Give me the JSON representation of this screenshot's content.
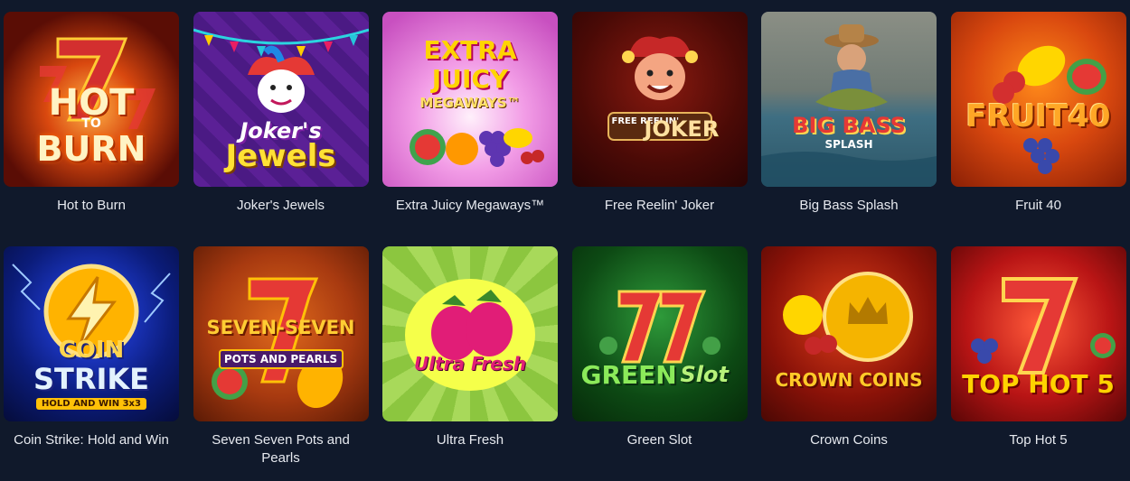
{
  "games": [
    {
      "title": "Hot to Burn",
      "logo": "HOT",
      "logo2": "TO",
      "logo3": "BURN",
      "icon": "flaming-seven-icon",
      "bg": "#5a0d05",
      "accent": "#ff7a1a"
    },
    {
      "title": "Joker's Jewels",
      "logo": "Joker's",
      "logo2": "Jewels",
      "icon": "jester-icon",
      "bg": "#4b1a84",
      "accent": "#ffd23a"
    },
    {
      "title": "Extra Juicy Megaways™",
      "logo": "EXTRA",
      "logo2": "JUICY",
      "logo3": "MEGAWAYS™",
      "icon": "fruit-icon",
      "bg": "#e07bd8",
      "accent": "#ffd400"
    },
    {
      "title": "Free Reelin' Joker",
      "logo": "FREE REELIN'",
      "logo2": "JOKER",
      "icon": "joker-face-icon",
      "bg": "#3a0806",
      "accent": "#e7b45a"
    },
    {
      "title": "Big Bass Splash",
      "logo": "BIG BASS",
      "logo2": "SPLASH",
      "icon": "fisherman-icon",
      "bg": "#4a6a76",
      "accent": "#d8261e"
    },
    {
      "title": "Fruit 40",
      "logo": "FRUIT40",
      "icon": "lemon-icon",
      "bg": "#c2410c",
      "accent": "#ffb300"
    },
    {
      "title": "Coin Strike: Hold and Win",
      "logo": "COIN",
      "logo2": "STRIKE",
      "logo3": "HOLD AND WIN 3x3",
      "icon": "lightning-coin-icon",
      "bg": "#0b1c7a",
      "accent": "#ffc107"
    },
    {
      "title": "Seven Seven Pots and Pearls",
      "logo": "SEVEN-SEVEN",
      "logo2": "POTS AND PEARLS",
      "icon": "seven-icon",
      "bg": "#a83a10",
      "accent": "#ffb020"
    },
    {
      "title": "Ultra Fresh",
      "logo": "Ultra Fresh",
      "icon": "raspberry-icon",
      "bg": "#9ccc3a",
      "accent": "#e11d77"
    },
    {
      "title": "Green Slot",
      "logo": "GREEN",
      "logo2": "Slot",
      "icon": "seven-icon",
      "bg": "#0d4a14",
      "accent": "#e5342b"
    },
    {
      "title": "Crown Coins",
      "logo": "CROWN COINS",
      "icon": "crown-coin-icon",
      "bg": "#8a1208",
      "accent": "#f5c542"
    },
    {
      "title": "Top Hot 5",
      "logo": "TOP HOT 5",
      "icon": "seven-icon",
      "bg": "#9e0f0f",
      "accent": "#ffd200"
    }
  ]
}
